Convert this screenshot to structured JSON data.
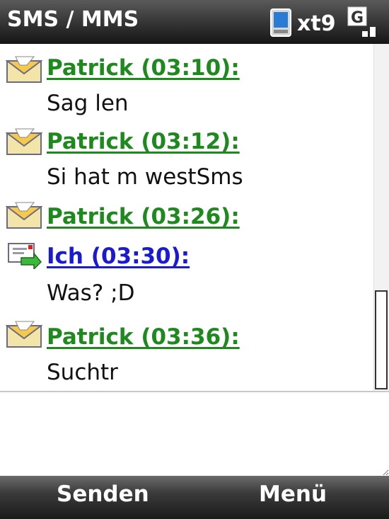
{
  "title_bar": {
    "title": "SMS / MMS",
    "carrier": "xt9",
    "network_letter": "G",
    "icons": [
      "device-icon",
      "signal-g-icon"
    ]
  },
  "messages": [
    {
      "sender": "Patrick (03:10):",
      "text": "Sag len",
      "icon": "received-envelope-icon",
      "direction": "incoming"
    },
    {
      "sender": "Patrick (03:12):",
      "text": "Si hat m westSms",
      "icon": "received-envelope-icon",
      "direction": "incoming"
    },
    {
      "sender": "Patrick (03:26):",
      "text": "",
      "icon": "received-envelope-icon",
      "direction": "incoming"
    },
    {
      "sender": "Ich (03:30):",
      "text": "Was? ;D",
      "icon": "sent-message-icon",
      "direction": "outgoing"
    },
    {
      "sender": "Patrick (03:36):",
      "text": "Suchtr",
      "icon": "received-envelope-icon",
      "direction": "incoming"
    }
  ],
  "colors": {
    "incoming_sender": "#1e8a1e",
    "outgoing_sender": "#1a1ad2"
  },
  "compose": {
    "value": ""
  },
  "softkeys": {
    "left": "Senden",
    "right": "Menü"
  }
}
